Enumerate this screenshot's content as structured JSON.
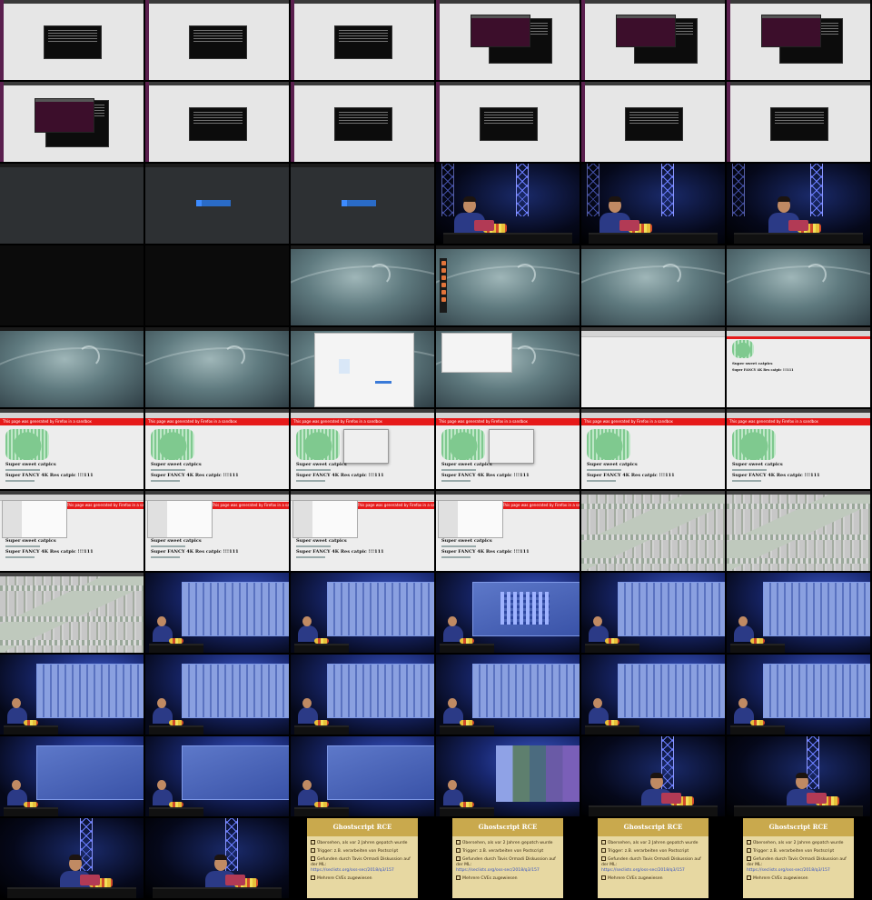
{
  "grid": {
    "columns": 6,
    "rows": 11
  },
  "tiles": [
    {
      "kind": "grey-terminal"
    },
    {
      "kind": "grey-terminal"
    },
    {
      "kind": "grey-terminal"
    },
    {
      "kind": "grey-terminal-purple"
    },
    {
      "kind": "grey-terminal-purple"
    },
    {
      "kind": "grey-terminal-purple"
    },
    {
      "kind": "grey-terminal-purple-left"
    },
    {
      "kind": "grey-terminal"
    },
    {
      "kind": "grey-terminal"
    },
    {
      "kind": "grey-terminal"
    },
    {
      "kind": "grey-terminal"
    },
    {
      "kind": "grey-terminal"
    },
    {
      "kind": "dark-empty"
    },
    {
      "kind": "dark-login"
    },
    {
      "kind": "dark-login"
    },
    {
      "kind": "stage-speaker"
    },
    {
      "kind": "stage-speaker"
    },
    {
      "kind": "stage-speaker-side"
    },
    {
      "kind": "black"
    },
    {
      "kind": "black"
    },
    {
      "kind": "debian"
    },
    {
      "kind": "debian-dock"
    },
    {
      "kind": "debian"
    },
    {
      "kind": "debian"
    },
    {
      "kind": "debian"
    },
    {
      "kind": "debian"
    },
    {
      "kind": "debian-dialog"
    },
    {
      "kind": "debian-window"
    },
    {
      "kind": "browser-blank"
    },
    {
      "kind": "browser-cat-small"
    },
    {
      "kind": "browser-cat-banner"
    },
    {
      "kind": "browser-cat-banner"
    },
    {
      "kind": "browser-cat-dialog"
    },
    {
      "kind": "browser-cat-dialog"
    },
    {
      "kind": "browser-cat-banner"
    },
    {
      "kind": "browser-cat-banner"
    },
    {
      "kind": "browser-cat-files"
    },
    {
      "kind": "browser-cat-files"
    },
    {
      "kind": "browser-cat-files"
    },
    {
      "kind": "browser-cat-files"
    },
    {
      "kind": "pixel"
    },
    {
      "kind": "pixel"
    },
    {
      "kind": "pixel"
    },
    {
      "kind": "proj-pix"
    },
    {
      "kind": "proj-pix"
    },
    {
      "kind": "proj-blocks"
    },
    {
      "kind": "proj-pix"
    },
    {
      "kind": "proj-pix"
    },
    {
      "kind": "proj-pix"
    },
    {
      "kind": "proj-pix"
    },
    {
      "kind": "proj-pix"
    },
    {
      "kind": "proj-pix"
    },
    {
      "kind": "proj-pix"
    },
    {
      "kind": "proj-pix"
    },
    {
      "kind": "proj-plain"
    },
    {
      "kind": "proj-plain"
    },
    {
      "kind": "proj-plain"
    },
    {
      "kind": "proj-stripes"
    },
    {
      "kind": "stage-speaker-close"
    },
    {
      "kind": "stage-speaker-close"
    },
    {
      "kind": "stage-speaker-close"
    },
    {
      "kind": "stage-speaker-close"
    },
    {
      "kind": "slide"
    },
    {
      "kind": "slide"
    },
    {
      "kind": "slide"
    },
    {
      "kind": "slide"
    }
  ],
  "catpage": {
    "banner": "This page was generated by Firefox in a sandbox",
    "title": "Super sweet catpics",
    "subtitle": "Super FANCY 4K Res catpic !!!111"
  },
  "slide": {
    "title": "Ghostscript RCE",
    "items": [
      {
        "text": "Übersehen, als vor 2 Jahren gepatch wurde"
      },
      {
        "text": "Trigger: z.B. verarbeiten von Postscript"
      },
      {
        "text": "Gefunden durch Tavis Ormadi Diskussion auf der ML:",
        "link": "https://seclists.org/oss-sec/2018/q3/157"
      },
      {
        "text": "Mehrere CVEs zugewiesen"
      }
    ]
  },
  "colors": {
    "purple_terminal": "#3c0e2b",
    "banner_red": "#e61a1a",
    "stage_blue": "#1a2a6a",
    "slide_gold": "#c9a94d"
  }
}
